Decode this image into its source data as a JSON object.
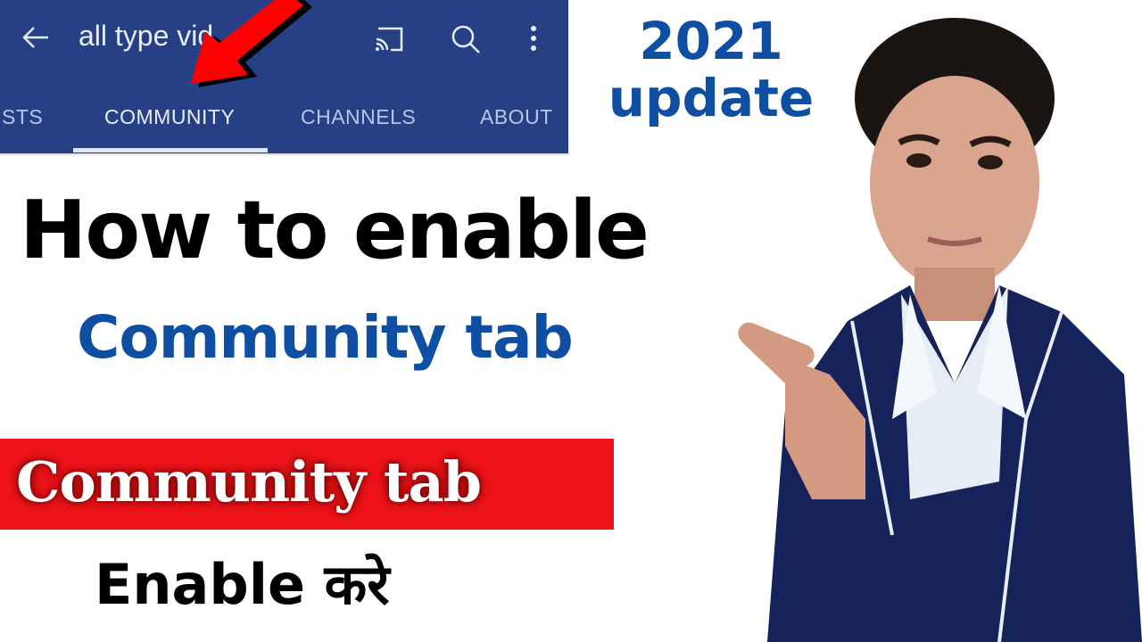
{
  "app_bar": {
    "channel_title": "all type vid",
    "icons": [
      "back-arrow-icon",
      "cast-icon",
      "search-icon",
      "more-vertical-icon"
    ],
    "background_color": "#263f85"
  },
  "tabs": [
    {
      "label": "STS",
      "active": false
    },
    {
      "label": "COMMUNITY",
      "active": true
    },
    {
      "label": "CHANNELS",
      "active": false
    },
    {
      "label": "ABOUT",
      "active": false
    }
  ],
  "headline": {
    "year_badge_line1": "2021",
    "year_badge_line2": "update",
    "line1": "How to enable",
    "line2": "Community tab",
    "banner": "Community tab",
    "footer": "Enable करे"
  },
  "colors": {
    "accent_blue": "#0e4fa3",
    "banner_red": "#f0141a",
    "pointer_arrow_red": "#ff0000"
  }
}
